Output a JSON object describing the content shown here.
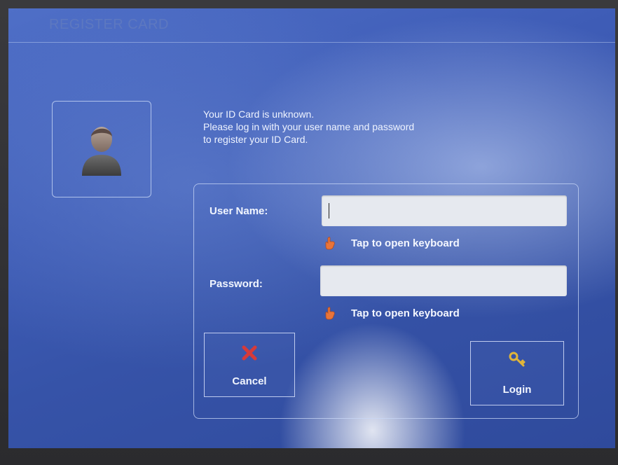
{
  "header": {
    "title": "REGISTER CARD"
  },
  "message": {
    "lines": [
      "Your ID Card is unknown.",
      "Please log in with your user name and password",
      "to register your ID Card."
    ]
  },
  "form": {
    "username_label": "User Name:",
    "username_value": "",
    "password_label": "Password:",
    "password_value": "",
    "keyboard_hint": "Tap to open keyboard"
  },
  "buttons": {
    "cancel_label": "Cancel",
    "login_label": "Login"
  },
  "icons": {
    "avatar": "user-silhouette-icon",
    "hand": "pointing-hand-icon",
    "cancel": "red-x-icon",
    "login": "key-icon"
  },
  "colors": {
    "background": "#3e5cb6",
    "cancel_icon": "#d63a3a",
    "key_icon": "#e0b53a",
    "hand_icon": "#e8743a"
  }
}
